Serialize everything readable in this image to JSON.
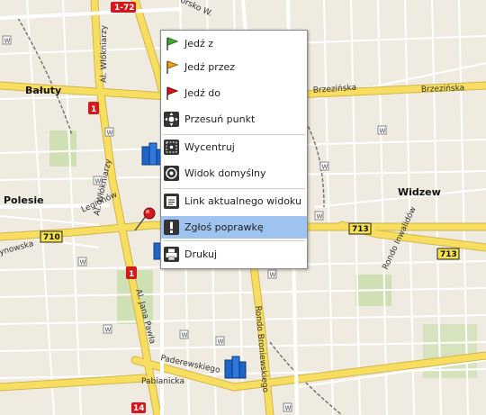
{
  "map": {
    "districts": {
      "balut": "Bałuty",
      "polesie": "Polesie",
      "widzew": "Widzew"
    },
    "streets": {
      "wlokniarzy_top": "Al. Włókniarzy",
      "wlokniarzy_mid": "Al. Włókniarzy",
      "brzezinska_1": "Brzezińska",
      "brzezinska_2": "Brzezińska",
      "legionow": "Legionów",
      "jana_pawla": "Al. Jana Pawła",
      "rondo_bronewskiego": "Rondo Broniewskiego",
      "paderewskiego": "Paderewskiego",
      "pabianicka": "Pabianicka",
      "rondo_inwalidow": "Rondo Inwalidów",
      "konstantynowska": "ynowska",
      "zgierska_top": "orsko W."
    },
    "shields": {
      "a1_top": "1-72",
      "n1_a": "1",
      "n1_b": "1",
      "n710": "710",
      "n713_a": "713",
      "n713_b": "713",
      "n14": "14"
    },
    "w_marker": "W"
  },
  "context_menu": {
    "items": [
      {
        "label": "Jedź z",
        "icon": "green-flag-icon"
      },
      {
        "label": "Jedź przez",
        "icon": "orange-flag-icon"
      },
      {
        "label": "Jedź do",
        "icon": "red-flag-icon"
      },
      {
        "label": "Przesuń punkt",
        "icon": "move-point-icon"
      },
      {
        "label": "Wycentruj",
        "icon": "center-icon"
      },
      {
        "label": "Widok domyślny",
        "icon": "default-view-icon"
      },
      {
        "label": "Link aktualnego widoku",
        "icon": "link-icon"
      },
      {
        "label": "Zgłoś poprawkę",
        "icon": "report-icon"
      },
      {
        "label": "Drukuj",
        "icon": "print-icon"
      }
    ],
    "selected_index": 7
  },
  "colors": {
    "map_bg": "#efebe0",
    "road_yellow": "#f7de60",
    "road_outline": "#d2b64a",
    "route_shield_red": "#d6181b",
    "shield_yellow": "#f6e24a",
    "menu_highlight": "#9ec3ee"
  }
}
